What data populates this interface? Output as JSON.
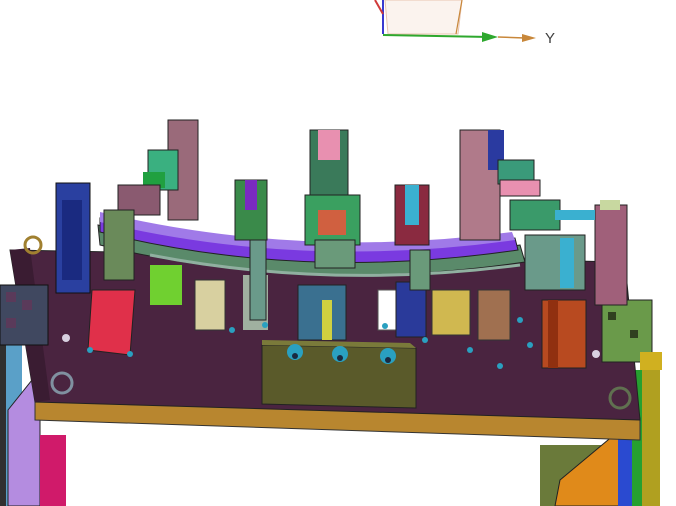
{
  "viewport": {
    "triad": {
      "y_axis_label": "Y",
      "y_axis_color": "#2ea82e",
      "y_arrow_color": "#c8873a",
      "x_axis_color": "#3a3ad0",
      "z_axis_color": "#d03a3a"
    },
    "model": {
      "plate_color": "#4a2440",
      "base_color": "#b8862f",
      "rail_color": "#7a3ae0"
    }
  }
}
